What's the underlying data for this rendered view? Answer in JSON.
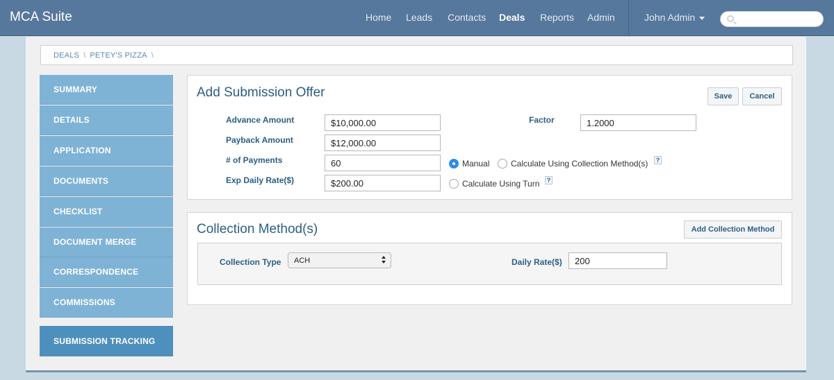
{
  "app": {
    "brand": "MCA Suite"
  },
  "nav": {
    "items": [
      {
        "label": "Home"
      },
      {
        "label": "Leads"
      },
      {
        "label": "Contacts"
      },
      {
        "label": "Deals"
      },
      {
        "label": "Reports"
      },
      {
        "label": "Admin"
      }
    ],
    "active": "Deals",
    "user": "John Admin",
    "search_value": ""
  },
  "breadcrumb": [
    "Deals",
    "Petey's Pizza"
  ],
  "sidebar": {
    "items": [
      {
        "label": "SUMMARY"
      },
      {
        "label": "DETAILS"
      },
      {
        "label": "APPLICATION"
      },
      {
        "label": "DOCUMENTS"
      },
      {
        "label": "CHECKLIST"
      },
      {
        "label": "DOCUMENT MERGE"
      },
      {
        "label": "CORRESPONDENCE"
      },
      {
        "label": "COMMISSIONS"
      }
    ],
    "tracking": {
      "label": "SUBMISSION TRACKING"
    }
  },
  "offer": {
    "title": "Add Submission Offer",
    "save_label": "Save",
    "cancel_label": "Cancel",
    "advance_amount": {
      "label": "Advance Amount",
      "value": "$10,000.00"
    },
    "payback_amount": {
      "label": "Payback Amount",
      "value": "$12,000.00"
    },
    "num_payments": {
      "label": "# of Payments",
      "value": "60"
    },
    "exp_daily_rate": {
      "label": "Exp Daily Rate($)",
      "value": "$200.00"
    },
    "factor": {
      "label": "Factor",
      "value": "1.2000"
    },
    "options": {
      "manual": "Manual",
      "collection": "Calculate Using Collection Method(s)",
      "turn": "Calculate Using Turn",
      "selected": "manual",
      "help": "?"
    }
  },
  "collection": {
    "title": "Collection Method(s)",
    "add_label": "Add Collection Method",
    "type_label": "Collection Type",
    "type_value": "ACH",
    "daily_rate_label": "Daily Rate($)",
    "daily_rate_value": "200"
  },
  "colors": {
    "navbar": "#56789c",
    "sidebar": "#7fb3d6",
    "sidebar_active": "#4e90bd",
    "accent": "#2c5e85",
    "radio": "#2f8de4"
  },
  "icons": {
    "search": "search-icon",
    "user_menu": "caret-down-icon",
    "select": "select-arrows-icon",
    "help": "help-icon"
  }
}
